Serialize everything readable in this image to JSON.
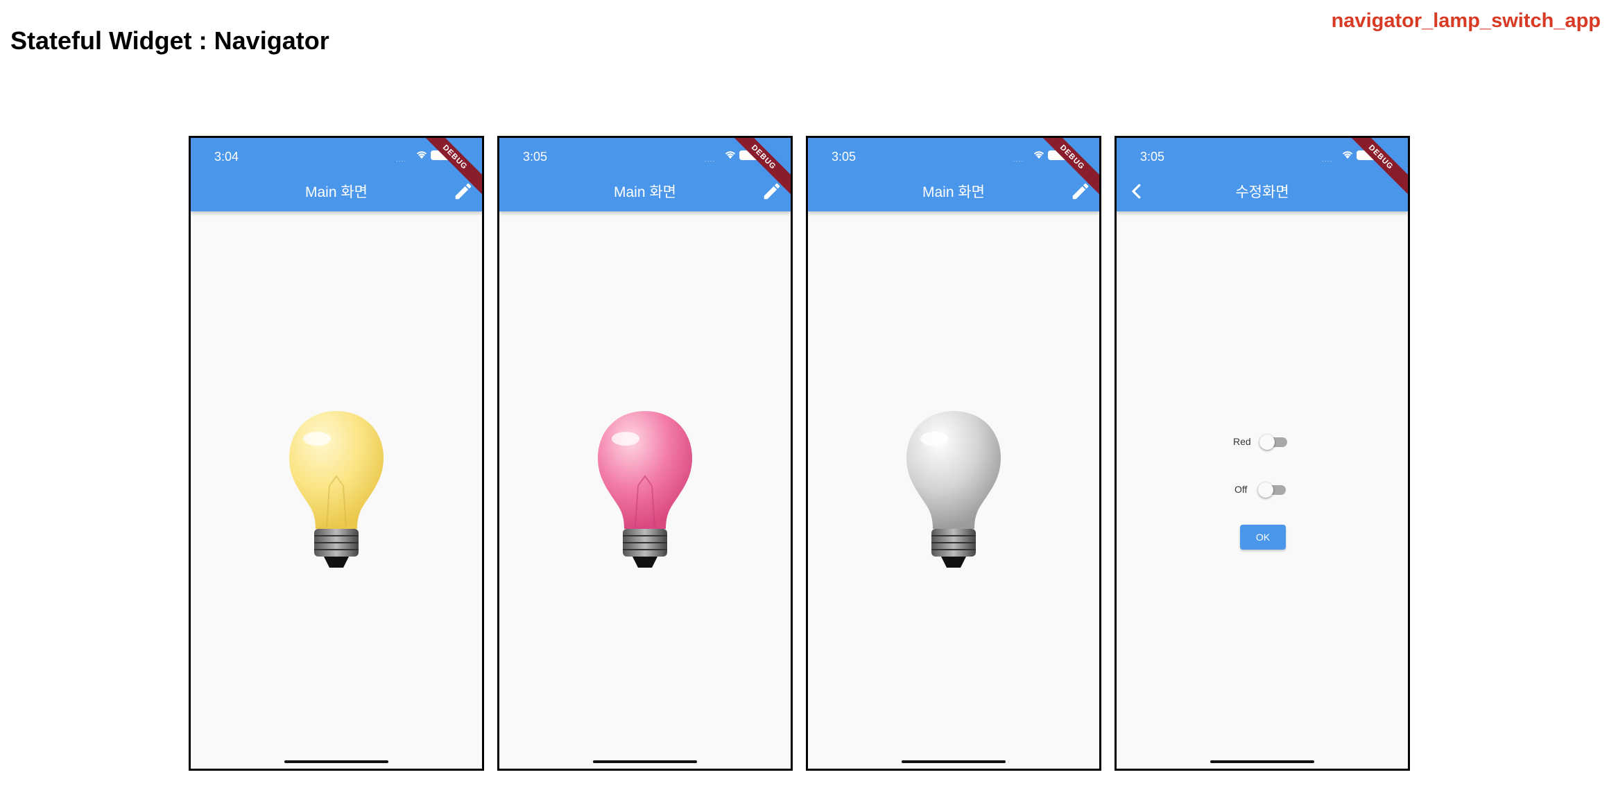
{
  "page": {
    "title": "Stateful Widget : Navigator",
    "app_name": "navigator_lamp_switch_app"
  },
  "colors": {
    "accent": "#4a96ea",
    "app_name": "#d93a24",
    "lamp_yellow": "#fbe27a",
    "lamp_red": "#f07aa3",
    "lamp_off": "#cfcfcf"
  },
  "screens": [
    {
      "time": "3:04",
      "title": "Main 화면",
      "debug": "DEBUG",
      "action_icon": "edit-icon",
      "lamp": "yellow"
    },
    {
      "time": "3:05",
      "title": "Main 화면",
      "debug": "DEBUG",
      "action_icon": "edit-icon",
      "lamp": "red"
    },
    {
      "time": "3:05",
      "title": "Main 화면",
      "debug": "DEBUG",
      "action_icon": "edit-icon",
      "lamp": "off"
    },
    {
      "time": "3:05",
      "title": "수정화면",
      "debug": "DEBUG",
      "leading_icon": "back-arrow-icon",
      "settings": {
        "color_label": "Red",
        "color_switch_on": false,
        "power_label": "Off",
        "power_switch_on": false,
        "ok_label": "OK"
      }
    }
  ]
}
